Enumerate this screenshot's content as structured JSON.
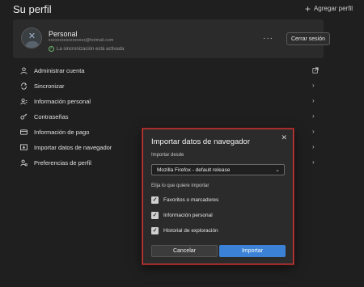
{
  "header": {
    "title": "Su perfil",
    "add_profile_label": "Agregar perfil",
    "add_profile_icon": "plus-icon"
  },
  "profile": {
    "name": "Personal",
    "email": "xxxxxxxxxxxxxxxxx@hotmail.com",
    "sync_status": "La sincronización está activada",
    "more_label": "···",
    "signout_label": "Cerrar sesión",
    "sync_color": "#6ab36a"
  },
  "menu": {
    "items": [
      {
        "label": "Administrar cuenta",
        "icon": "person-icon",
        "trailing": "external-link-icon"
      },
      {
        "label": "Sincronizar",
        "icon": "sync-icon",
        "trailing": "chevron-right-icon"
      },
      {
        "label": "Información personal",
        "icon": "contact-card-icon",
        "trailing": "chevron-right-icon"
      },
      {
        "label": "Contraseñas",
        "icon": "key-icon",
        "trailing": "chevron-right-icon"
      },
      {
        "label": "Información de pago",
        "icon": "credit-card-icon",
        "trailing": "chevron-right-icon"
      },
      {
        "label": "Importar datos de navegador",
        "icon": "import-icon",
        "trailing": "chevron-right-icon"
      },
      {
        "label": "Preferencias de perfil",
        "icon": "profile-settings-icon",
        "trailing": "chevron-right-icon"
      }
    ]
  },
  "dialog": {
    "title": "Importar datos de navegador",
    "close_label": "✕",
    "import_from_label": "Importar desde",
    "import_from_value": "Mozilla Firefox - default release",
    "choose_label": "Elija lo que quiere importar",
    "options": [
      {
        "label": "Favoritos o marcadores",
        "checked": true
      },
      {
        "label": "Información personal",
        "checked": true
      },
      {
        "label": "Historial de exploración",
        "checked": true
      }
    ],
    "cancel_label": "Cancelar",
    "import_label": "Importar",
    "accent_color": "#3b82d6",
    "border_color": "#c93a3a"
  }
}
